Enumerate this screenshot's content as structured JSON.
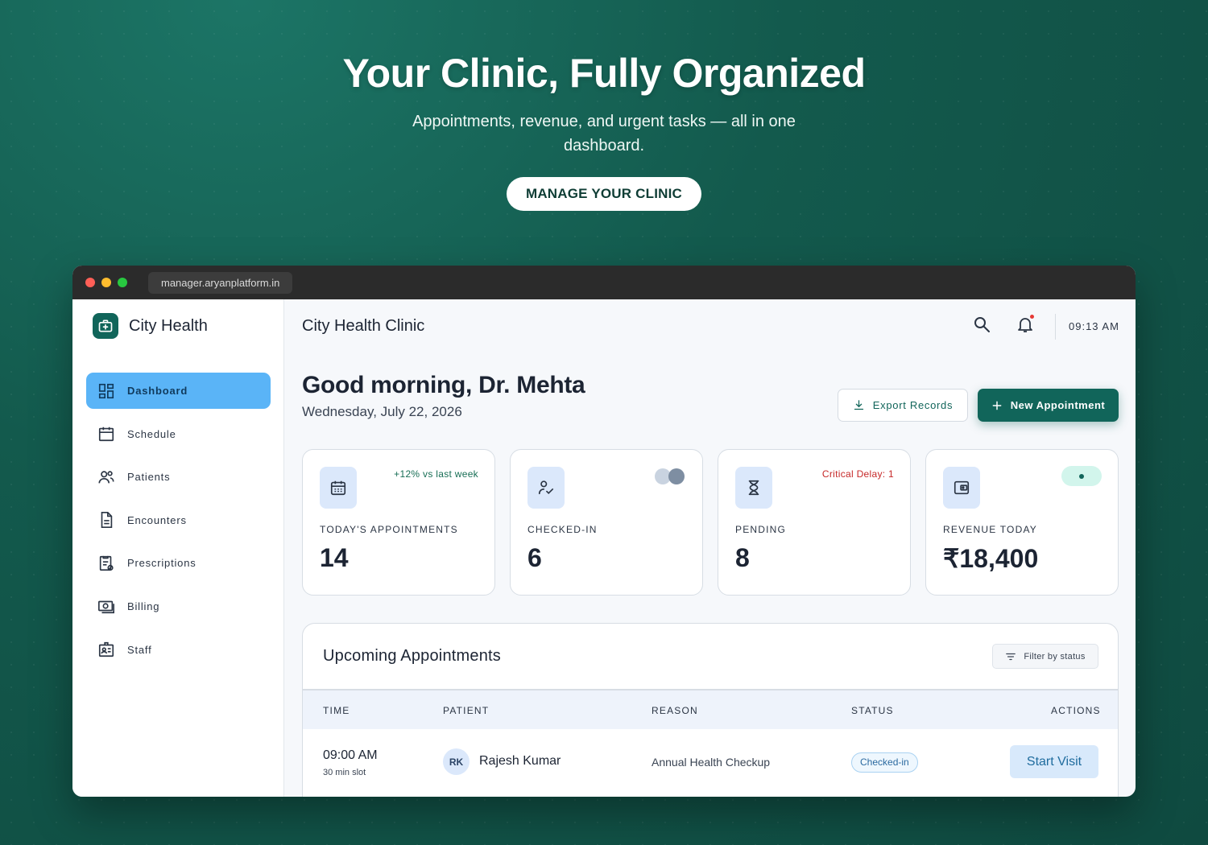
{
  "hero": {
    "title": "Your Clinic, Fully Organized",
    "subtitle": "Appointments, revenue, and urgent tasks — all in one dashboard.",
    "cta": "MANAGE YOUR CLINIC"
  },
  "browser": {
    "url": "manager.aryanplatform.in"
  },
  "sidebar": {
    "brand": "City Health",
    "items": [
      {
        "label": "Dashboard",
        "icon": "dashboard-icon",
        "active": true
      },
      {
        "label": "Schedule",
        "icon": "calendar-icon"
      },
      {
        "label": "Patients",
        "icon": "users-icon"
      },
      {
        "label": "Encounters",
        "icon": "document-icon"
      },
      {
        "label": "Prescriptions",
        "icon": "prescription-icon"
      },
      {
        "label": "Billing",
        "icon": "billing-icon"
      },
      {
        "label": "Staff",
        "icon": "staff-badge-icon"
      }
    ]
  },
  "topbar": {
    "title": "City Health Clinic",
    "time": "09:13 AM"
  },
  "header": {
    "greeting": "Good morning, Dr. Mehta",
    "date": "Wednesday, July 22, 2026",
    "export_label": "Export Records",
    "new_label": "New Appointment"
  },
  "stats": [
    {
      "label": "TODAY'S APPOINTMENTS",
      "value": "14",
      "badge": "+12% vs last week"
    },
    {
      "label": "CHECKED-IN",
      "value": "6"
    },
    {
      "label": "PENDING",
      "value": "8",
      "badge": "Critical Delay: 1"
    },
    {
      "label": "REVENUE TODAY",
      "value": "₹18,400"
    }
  ],
  "appointments": {
    "title": "Upcoming Appointments",
    "filter_label": "Filter by status",
    "columns": [
      "TIME",
      "PATIENT",
      "REASON",
      "STATUS",
      "ACTIONS"
    ],
    "rows": [
      {
        "time": "09:00 AM",
        "slot": "30 min slot",
        "initials": "RK",
        "patient": "Rajesh Kumar",
        "reason": "Annual Health Checkup",
        "status": "Checked-in",
        "action": "Start Visit"
      }
    ]
  },
  "colors": {
    "brand": "#11655a",
    "active_nav": "#5ab4f7",
    "critical": "#c62828",
    "positive": "#176e55"
  }
}
